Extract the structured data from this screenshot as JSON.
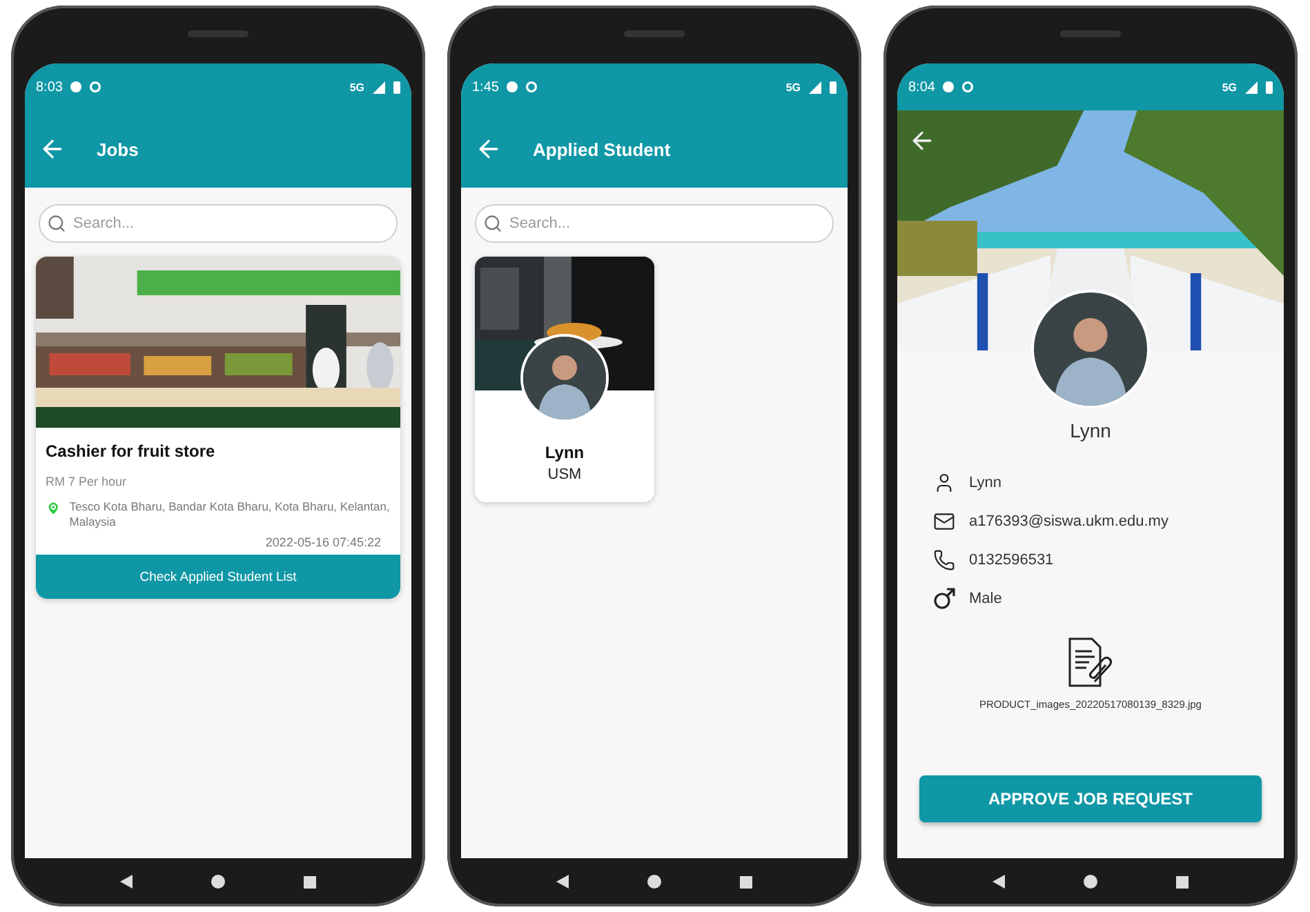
{
  "jobs_screen": {
    "status": {
      "time": "8:03",
      "network": "5G"
    },
    "title": "Jobs",
    "search": {
      "placeholder": "Search..."
    },
    "job": {
      "title": "Cashier for fruit store",
      "pay": "RM 7 Per hour",
      "location": "Tesco Kota Bharu, Bandar Kota Bharu, Kota Bharu, Kelantan, Malaysia",
      "date": "2022-05-16 07:45:22",
      "button": "Check Applied Student List"
    }
  },
  "applied_screen": {
    "status": {
      "time": "1:45",
      "network": "5G"
    },
    "title": "Applied Student",
    "search": {
      "placeholder": "Search..."
    },
    "students": [
      {
        "name": "Lynn",
        "school": "USM"
      }
    ]
  },
  "profile_screen": {
    "status": {
      "time": "8:04",
      "network": "5G"
    },
    "name": "Lynn",
    "details": [
      {
        "kind": "person",
        "text": "Lynn"
      },
      {
        "kind": "email",
        "text": "a176393@siswa.ukm.edu.my"
      },
      {
        "kind": "phone",
        "text": "0132596531"
      },
      {
        "kind": "gender",
        "text": "Male"
      }
    ],
    "attachment": "PRODUCT_images_20220517080139_8329.jpg",
    "button": "APPROVE JOB REQUEST"
  }
}
